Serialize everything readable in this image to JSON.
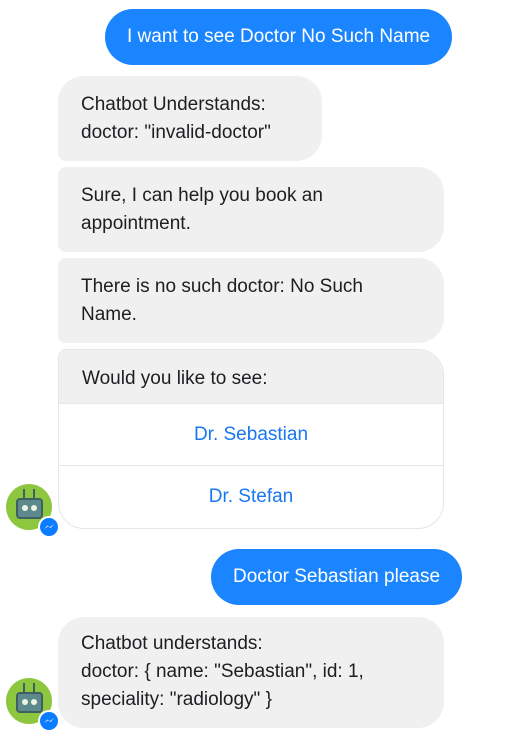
{
  "messages": {
    "user_1": "I want to see Doctor No Such Name",
    "bot_understands_1": [
      "Chatbot Understands:",
      "doctor: \"invalid-doctor\""
    ],
    "bot_reply_1": [
      "Sure, I can help you book an",
      "appointment."
    ],
    "bot_reply_2": [
      "There is no such doctor: No Such",
      "Name."
    ],
    "user_2": "Doctor Sebastian please",
    "bot_understands_2": [
      "Chatbot understands:",
      "doctor: { name: \"Sebastian\", id: 1,",
      "speciality: \"radiology\" }"
    ]
  },
  "quick_reply_card": {
    "prompt": "Would you like to see:",
    "options": [
      "Dr. Sebastian",
      "Dr. Stefan"
    ]
  },
  "avatar": {
    "icon": "robot-tv-icon",
    "badge_icon": "messenger-icon"
  },
  "colors": {
    "outgoing": "#1a85ff",
    "incoming": "#f0f0f0",
    "link": "#1877f2",
    "avatar": "#8dc63f"
  }
}
